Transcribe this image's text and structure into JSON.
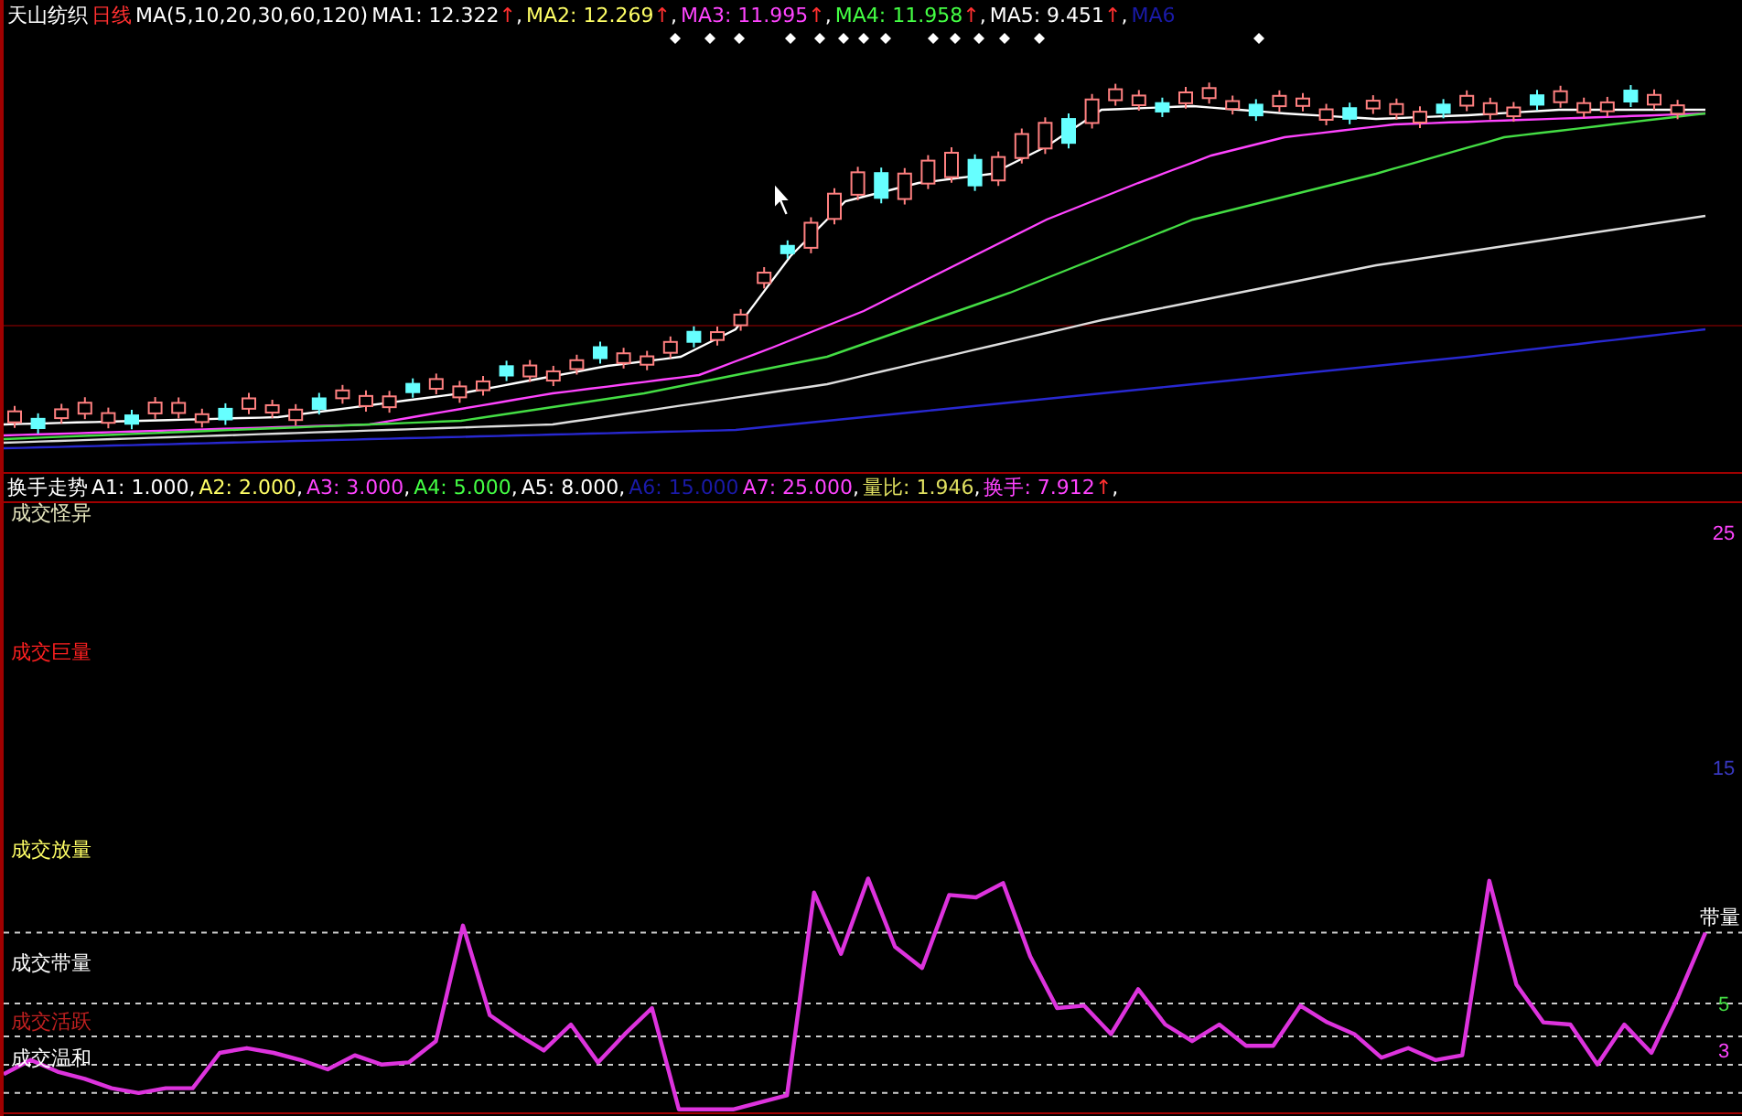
{
  "price_panel": {
    "stock_name": "天山纺织",
    "period": "日线",
    "ma_params": "MA(5,10,20,30,60,120)",
    "legend": [
      {
        "text": "MA1: 12.322",
        "arrow": "↑",
        "sep": ",",
        "color": "#ffffff"
      },
      {
        "text": "MA2: 12.269",
        "arrow": "↑",
        "sep": ",",
        "color": "#ffff66"
      },
      {
        "text": "MA3: 11.995",
        "arrow": "↑",
        "sep": ",",
        "color": "#ff44ff"
      },
      {
        "text": "MA4: 11.958",
        "arrow": "↑",
        "sep": ",",
        "color": "#44ff44"
      },
      {
        "text": "MA5: 9.451",
        "arrow": "↑",
        "sep": ",",
        "color": "#ffffff"
      },
      {
        "text": "MA6",
        "color": "#1a1aa8"
      }
    ]
  },
  "indicator_panel": {
    "title": "换手走势",
    "legend": [
      {
        "text": "A1: 1.000",
        "sep": ",",
        "color": "#ffffff"
      },
      {
        "text": "A2: 2.000",
        "sep": ",",
        "color": "#ffff66"
      },
      {
        "text": "A3: 3.000",
        "sep": ",",
        "color": "#ff44ff"
      },
      {
        "text": "A4: 5.000",
        "sep": ",",
        "color": "#44ff44"
      },
      {
        "text": "A5: 8.000",
        "sep": ",",
        "color": "#ffffff"
      },
      {
        "text": "A6: 15.000",
        "color": "#1a1aa8"
      },
      {
        "text": "A7: 25.000",
        "sep": ",",
        "color": "#ff44ff"
      },
      {
        "text": "量比: 1.946",
        "sep": ",",
        "color": "#e0e060"
      },
      {
        "text": "换手: 7.912",
        "arrow": "↑",
        "sep": ",",
        "color": "#ff44ff"
      }
    ],
    "zones": [
      {
        "label": "成交怪异",
        "color": "#e8e8c0"
      },
      {
        "label": "成交巨量",
        "color": "#ff2020"
      },
      {
        "label": "成交放量",
        "color": "#ffff66"
      },
      {
        "label": "成交带量",
        "color": "#ffffff"
      },
      {
        "label": "成交活跃",
        "color": "#c02020"
      },
      {
        "label": "成交温和",
        "color": "#ffffff"
      }
    ],
    "right_label": "带量",
    "chart_data": {
      "type": "line",
      "ylim": [
        0.3,
        26.3
      ],
      "yticks": [
        3,
        5,
        15,
        25
      ],
      "series": [
        {
          "color": "#dd33dd",
          "values": [
            2.0,
            2.6,
            2.1,
            1.8,
            1.4,
            1.2,
            1.4,
            1.4,
            2.9,
            3.1,
            2.9,
            2.6,
            2.2,
            2.8,
            2.4,
            2.5,
            3.4,
            8.3,
            4.5,
            3.7,
            3.0,
            4.1,
            2.5,
            3.7,
            4.8,
            0.5,
            0.5,
            0.5,
            0.8,
            1.1,
            9.7,
            7.1,
            10.3,
            7.4,
            6.5,
            9.6,
            9.5,
            10.1,
            7.0,
            4.8,
            4.9,
            3.7,
            5.6,
            4.1,
            3.4,
            4.1,
            3.2,
            3.2,
            4.9,
            4.2,
            3.7,
            2.7,
            3.1,
            2.6,
            2.8,
            10.2,
            5.8,
            4.2,
            4.1,
            2.4,
            4.1,
            2.9,
            5.3,
            8.0
          ]
        }
      ]
    }
  }
}
